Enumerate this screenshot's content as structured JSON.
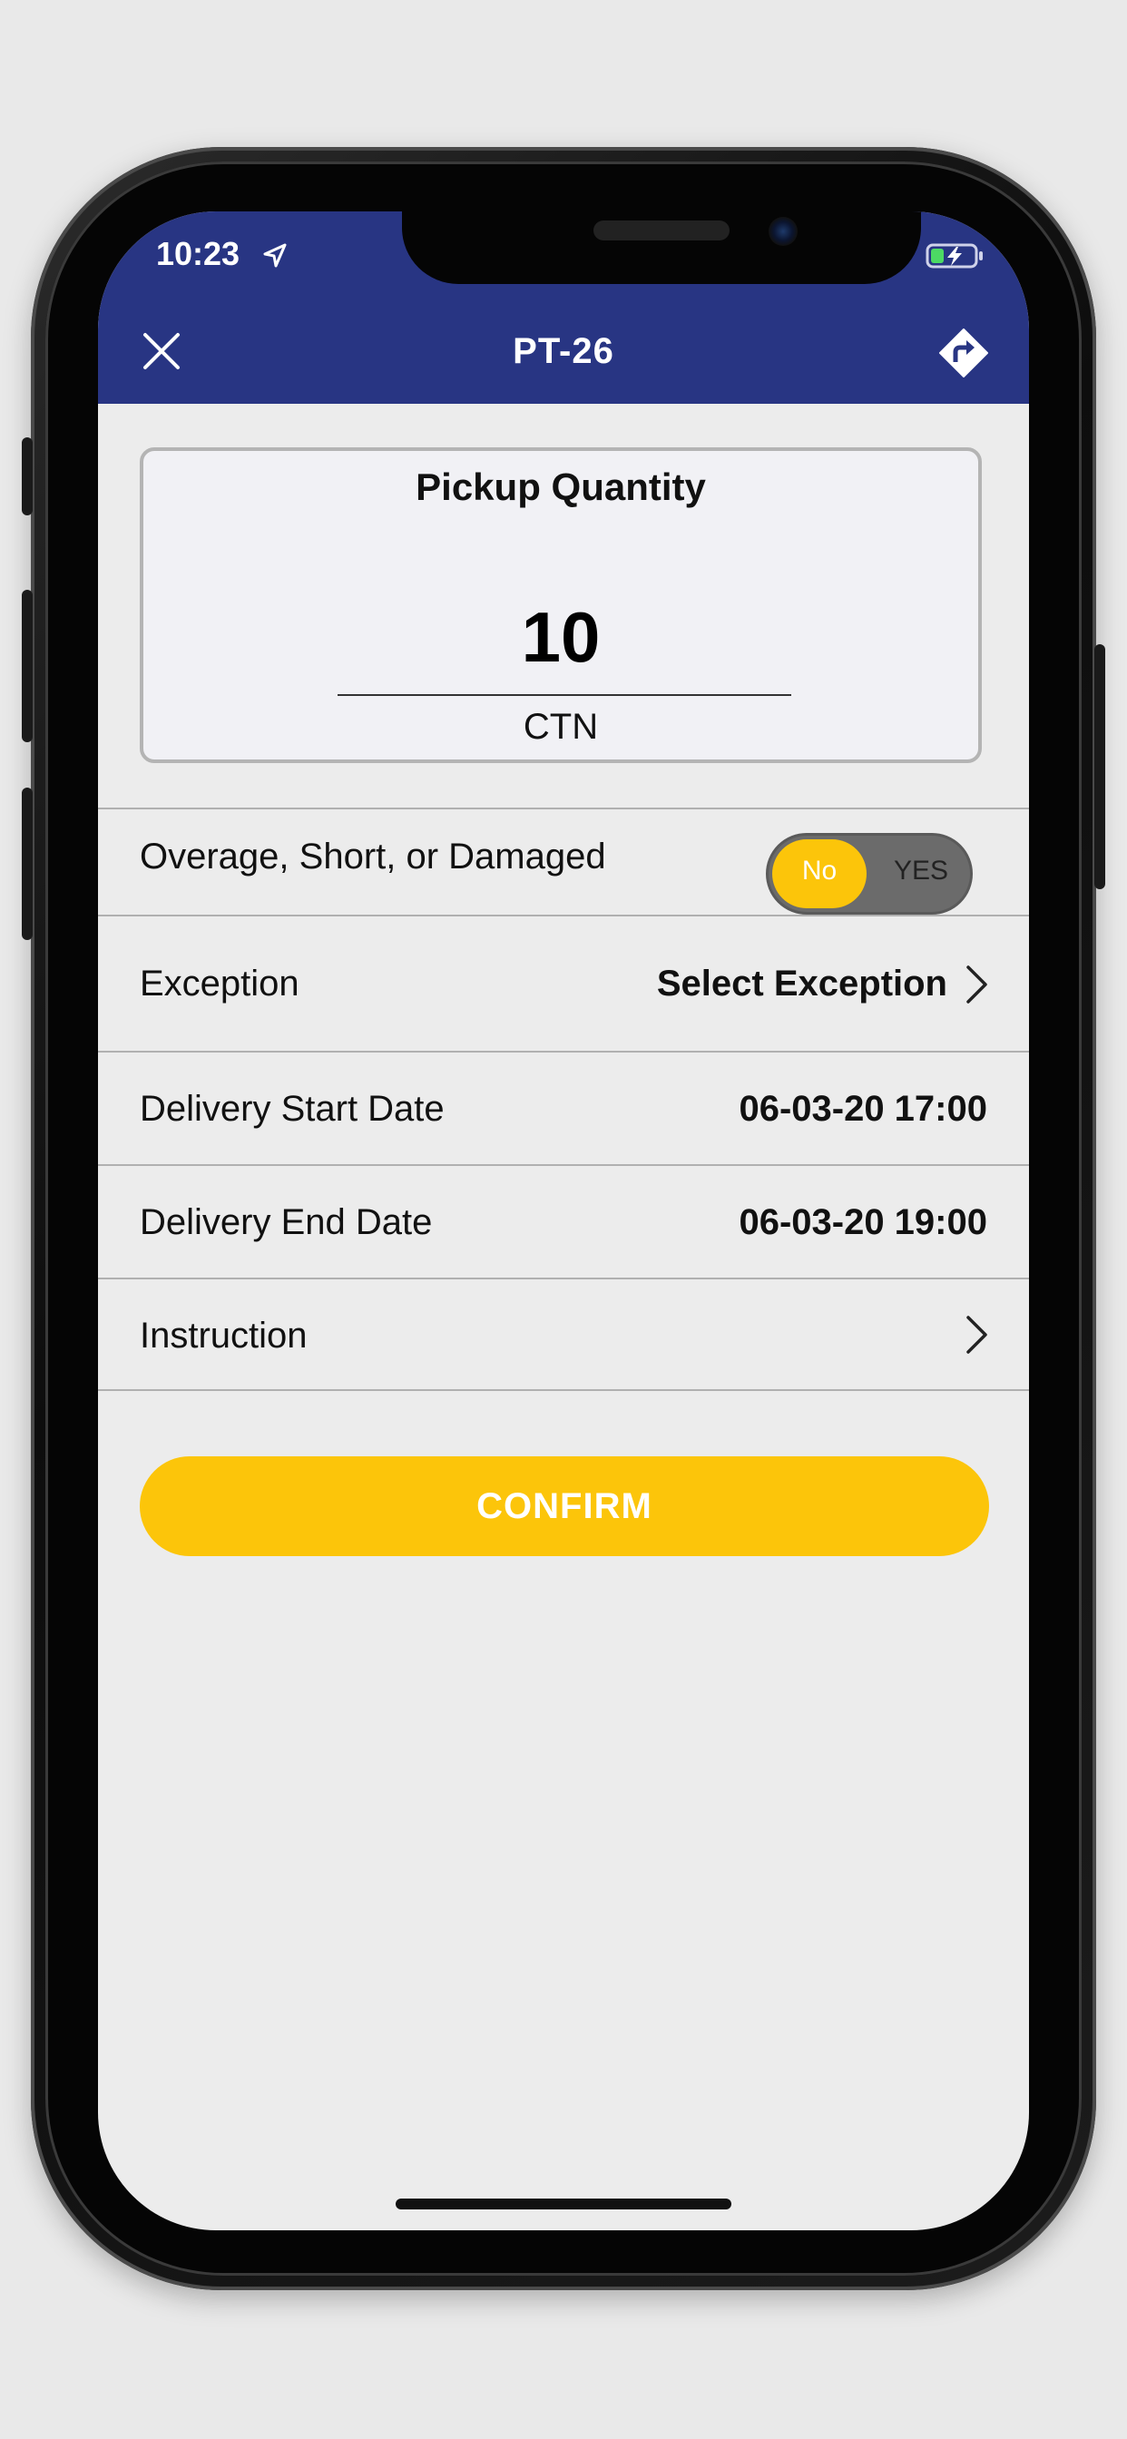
{
  "status_bar": {
    "time": "10:23"
  },
  "header": {
    "title": "PT-26"
  },
  "pickup": {
    "title": "Pickup Quantity",
    "quantity": "10",
    "unit": "CTN"
  },
  "osd": {
    "label": "Overage, Short, or Damaged",
    "toggle_no": "No",
    "toggle_yes": "YES",
    "selected": "No"
  },
  "exception": {
    "label": "Exception",
    "value": "Select Exception"
  },
  "delivery_start": {
    "label": "Delivery Start Date",
    "value": "06-03-20 17:00"
  },
  "delivery_end": {
    "label": "Delivery End Date",
    "value": "06-03-20 19:00"
  },
  "instruction": {
    "label": "Instruction"
  },
  "confirm": {
    "label": "CONFIRM"
  },
  "colors": {
    "header": "#283583",
    "accent": "#fcc50a",
    "toggle_track": "#6b6b6b"
  }
}
